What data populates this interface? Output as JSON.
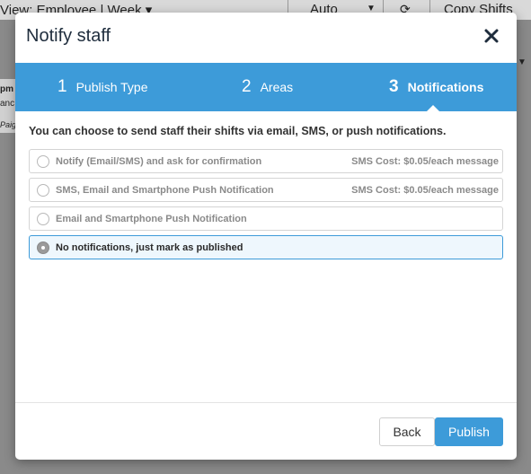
{
  "background": {
    "view_label": "View: Employee | Week ▾",
    "auto_label": "Auto",
    "copy_label": "Copy Shifts",
    "side_text_1": "pm",
    "side_text_2": "anc",
    "side_text_3": "Paige"
  },
  "modal": {
    "title": "Notify staff",
    "steps": [
      {
        "number": "1",
        "label": "Publish Type",
        "active": false
      },
      {
        "number": "2",
        "label": "Areas",
        "active": false
      },
      {
        "number": "3",
        "label": "Notifications",
        "active": true
      }
    ],
    "intro": "You can choose to send staff their shifts via email, SMS, or push notifications.",
    "options": [
      {
        "label": "Notify (Email/SMS) and ask for confirmation",
        "cost": "SMS Cost: $0.05/each message",
        "selected": false
      },
      {
        "label": "SMS, Email and Smartphone Push Notification",
        "cost": "SMS Cost: $0.05/each message",
        "selected": false
      },
      {
        "label": "Email and Smartphone Push Notification",
        "cost": "",
        "selected": false
      },
      {
        "label": "No notifications, just mark as published",
        "cost": "",
        "selected": true
      }
    ],
    "buttons": {
      "back": "Back",
      "publish": "Publish"
    }
  },
  "colors": {
    "accent": "#3d9bd9",
    "overlay": "#8a8a8a"
  }
}
